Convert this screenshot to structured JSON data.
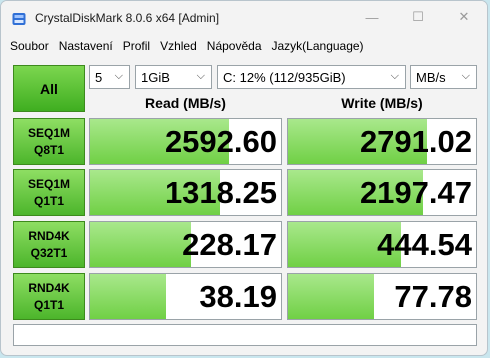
{
  "window": {
    "title": "CrystalDiskMark 8.0.6 x64 [Admin]",
    "minimize_glyph": "—",
    "maximize_glyph": "☐",
    "close_glyph": "✕"
  },
  "menu": [
    "Soubor",
    "Nastavení",
    "Profil",
    "Vzhled",
    "Nápověda",
    "Jazyk(Language)"
  ],
  "toolbar": {
    "all_label": "All",
    "count": "5",
    "size": "1GiB",
    "drive": "C: 12% (112/935GiB)",
    "unit": "MB/s"
  },
  "headers": {
    "read": "Read (MB/s)",
    "write": "Write (MB/s)"
  },
  "tests": [
    {
      "line1": "SEQ1M",
      "line2": "Q8T1",
      "read": "2592.60",
      "write": "2791.02",
      "read_fill": 0.73,
      "write_fill": 0.74
    },
    {
      "line1": "SEQ1M",
      "line2": "Q1T1",
      "read": "1318.25",
      "write": "2197.47",
      "read_fill": 0.68,
      "write_fill": 0.72
    },
    {
      "line1": "RND4K",
      "line2": "Q32T1",
      "read": "228.17",
      "write": "444.54",
      "read_fill": 0.53,
      "write_fill": 0.6
    },
    {
      "line1": "RND4K",
      "line2": "Q1T1",
      "read": "38.19",
      "write": "77.78",
      "read_fill": 0.4,
      "write_fill": 0.46
    }
  ],
  "status": ""
}
